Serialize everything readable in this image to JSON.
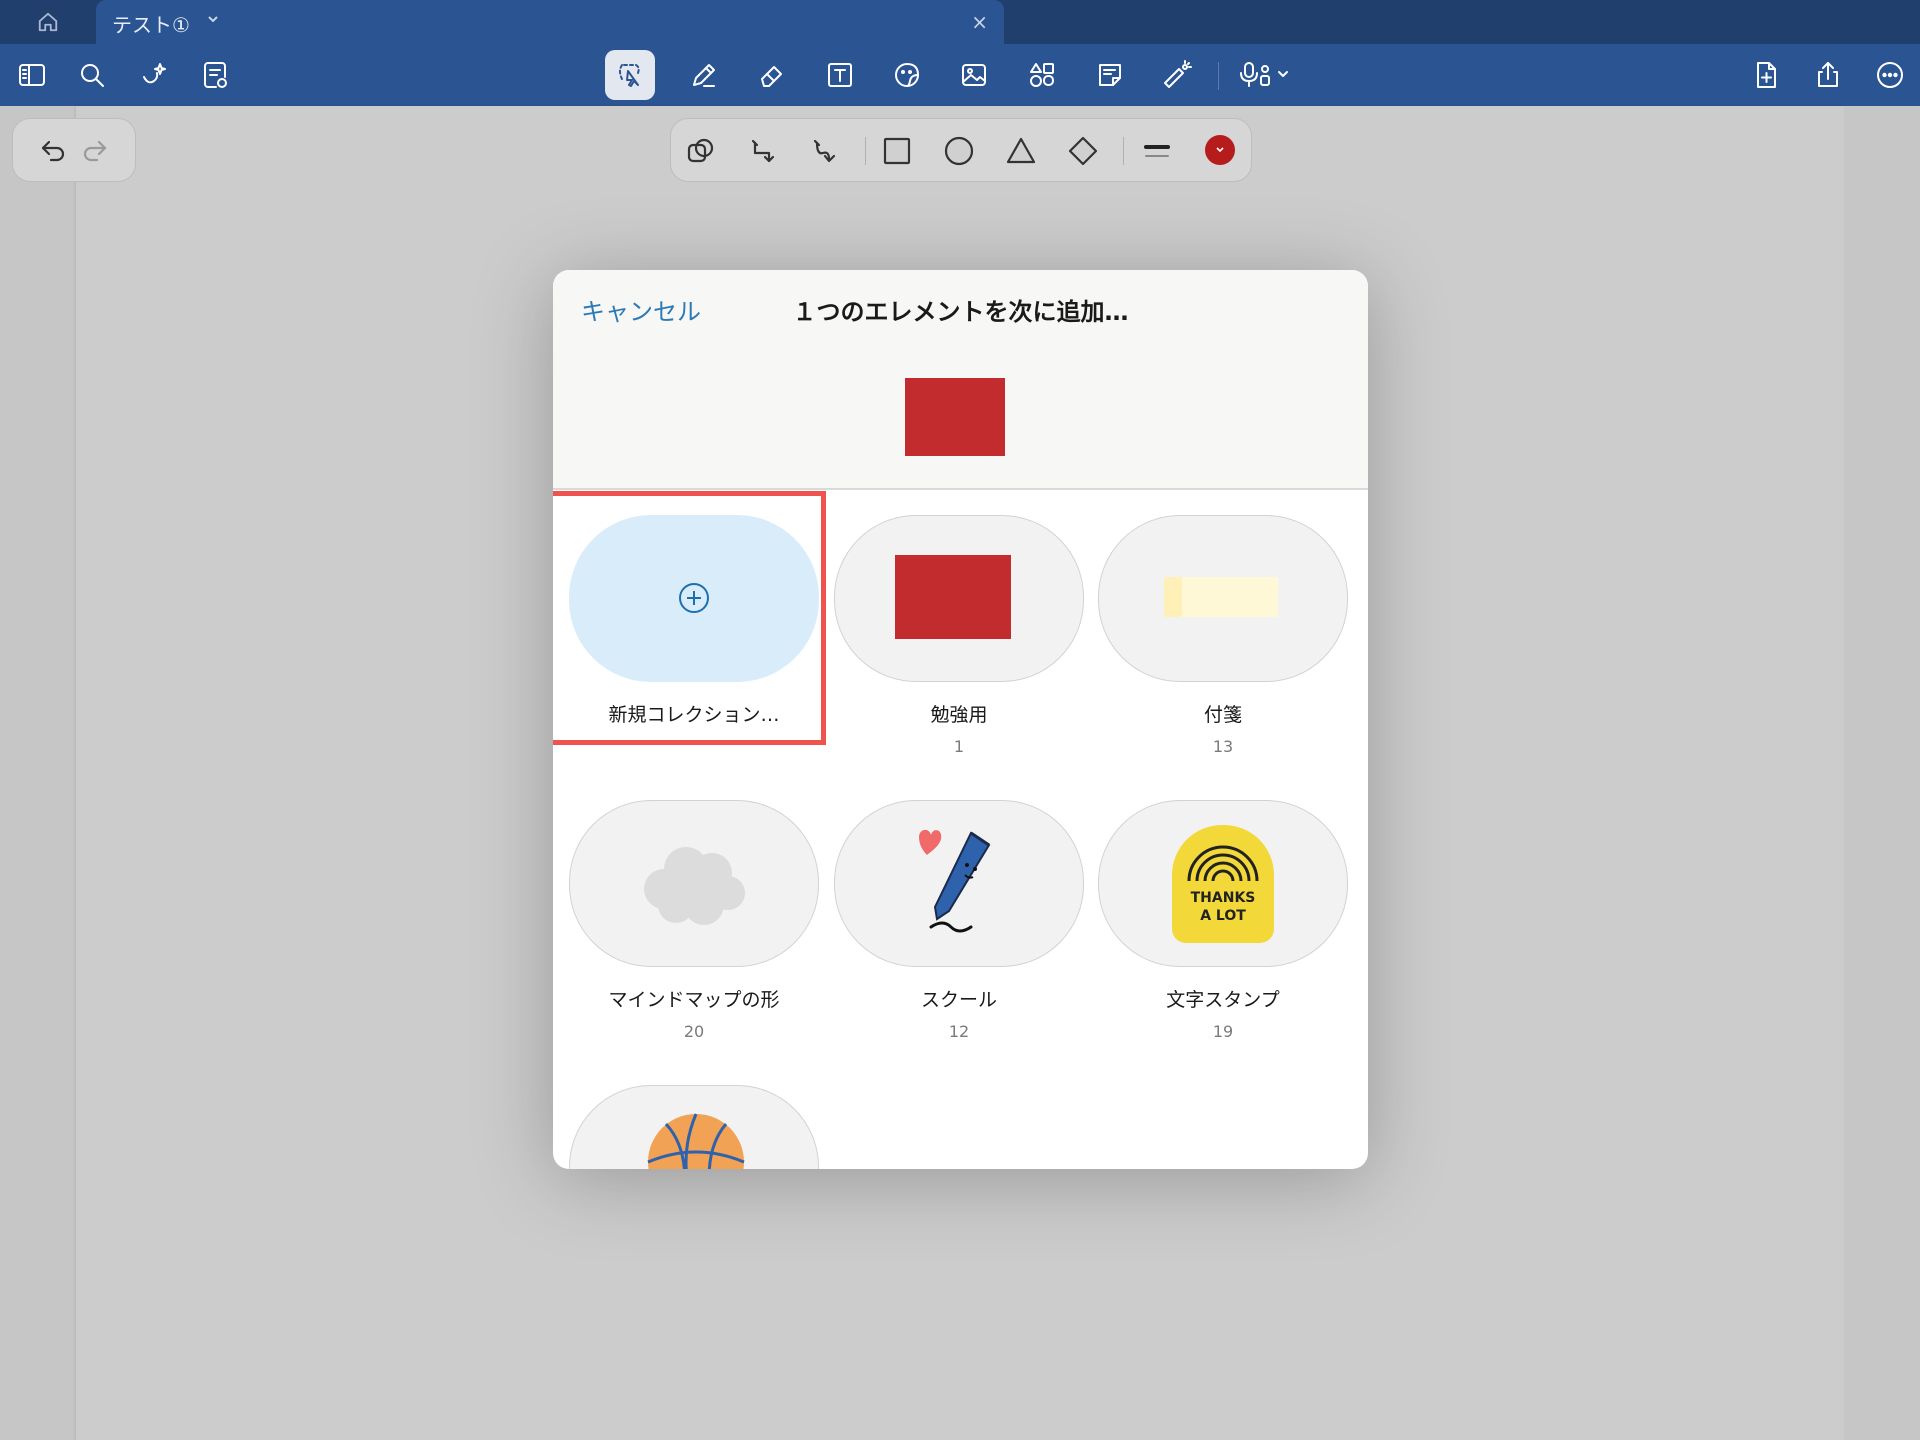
{
  "tabbar": {
    "tab_title": "テスト①",
    "close_glyph": "×"
  },
  "toolbar": {
    "left_icons": [
      "sidebar-icon",
      "search-icon",
      "sparkle-icon",
      "document-view-icon"
    ],
    "center_icons": [
      "lasso-icon",
      "pen-icon",
      "eraser-icon",
      "text-box-icon",
      "sticker-icon",
      "image-icon",
      "shapes-icon",
      "sticky-note-icon",
      "laser-pointer-icon",
      "microphone-icon"
    ],
    "right_icons": [
      "add-page-icon",
      "share-icon",
      "more-icon"
    ],
    "accent": "#2b5492"
  },
  "shape_toolbar": {
    "icons": [
      "shape-recognition-icon",
      "connector-elbow-icon",
      "connector-curve-icon",
      "square-icon",
      "circle-icon",
      "triangle-icon",
      "diamond-icon",
      "stroke-width-icon"
    ],
    "current_color": "#b71c1c"
  },
  "modal": {
    "cancel_label": "キャンセル",
    "title": "１つのエレメントを次に追加…",
    "preview_color": "#c22c2f",
    "items": [
      {
        "label": "新規コレクション…",
        "count": "",
        "icon": "plus-circle-icon"
      },
      {
        "label": "勉強用",
        "count": "1",
        "icon": "red-rect-thumbnail"
      },
      {
        "label": "付箋",
        "count": "13",
        "icon": "sticky-note-thumbnail"
      },
      {
        "label": "マインドマップの形",
        "count": "20",
        "icon": "cloud-thumbnail"
      },
      {
        "label": "スクール",
        "count": "12",
        "icon": "pen-with-heart-thumbnail"
      },
      {
        "label": "文字スタンプ",
        "count": "19",
        "icon": "thanks-a-lot-stamp-thumbnail",
        "stamp_text": [
          "THANKS",
          "A LOT"
        ]
      },
      {
        "label": "",
        "count": "",
        "icon": "basketball-thumbnail"
      }
    ]
  }
}
